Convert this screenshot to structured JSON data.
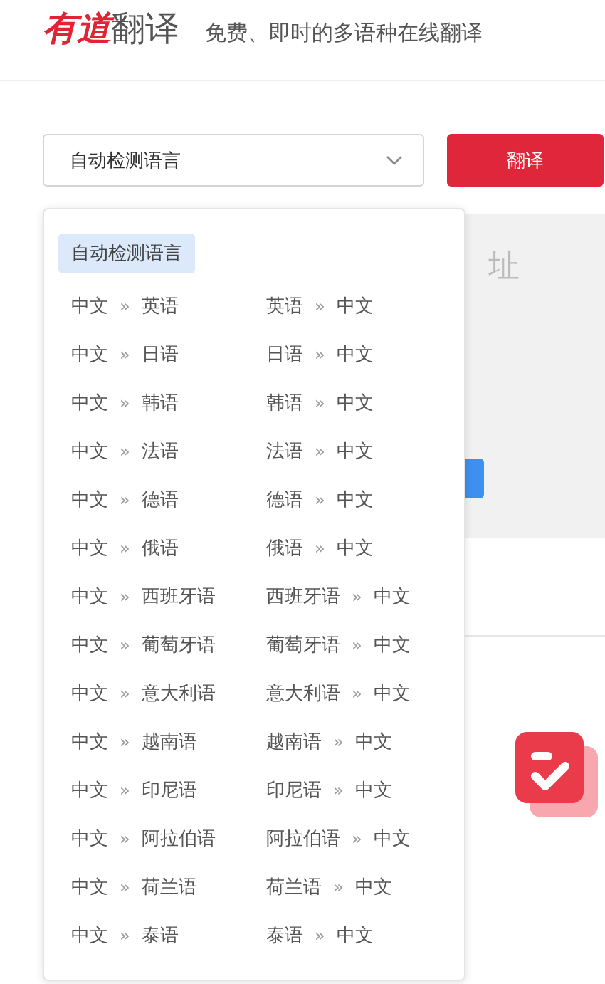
{
  "header": {
    "logo_brand": "有道",
    "logo_product": "翻译",
    "tagline": "免费、即时的多语种在线翻译"
  },
  "language_select": {
    "value": "自动检测语言",
    "expanded": true
  },
  "translate_button": "翻译",
  "input_panel": {
    "placeholder": "址"
  },
  "dropdown": {
    "auto_option": {
      "label": "自动检测语言",
      "selected": true
    },
    "pairs": [
      [
        {
          "from": "中文",
          "sep": "»",
          "to": "英语",
          "selected": false
        },
        {
          "from": "英语",
          "sep": "»",
          "to": "中文",
          "selected": false
        }
      ],
      [
        {
          "from": "中文",
          "sep": "»",
          "to": "日语",
          "selected": false
        },
        {
          "from": "日语",
          "sep": "»",
          "to": "中文",
          "selected": false
        }
      ],
      [
        {
          "from": "中文",
          "sep": "»",
          "to": "韩语",
          "selected": false
        },
        {
          "from": "韩语",
          "sep": "»",
          "to": "中文",
          "selected": false
        }
      ],
      [
        {
          "from": "中文",
          "sep": "»",
          "to": "法语",
          "selected": false
        },
        {
          "from": "法语",
          "sep": "»",
          "to": "中文",
          "selected": false
        }
      ],
      [
        {
          "from": "中文",
          "sep": "»",
          "to": "德语",
          "selected": false
        },
        {
          "from": "德语",
          "sep": "»",
          "to": "中文",
          "selected": false
        }
      ],
      [
        {
          "from": "中文",
          "sep": "»",
          "to": "俄语",
          "selected": false
        },
        {
          "from": "俄语",
          "sep": "»",
          "to": "中文",
          "selected": false
        }
      ],
      [
        {
          "from": "中文",
          "sep": "»",
          "to": "西班牙语",
          "selected": false
        },
        {
          "from": "西班牙语",
          "sep": "»",
          "to": "中文",
          "selected": false
        }
      ],
      [
        {
          "from": "中文",
          "sep": "»",
          "to": "葡萄牙语",
          "selected": false
        },
        {
          "from": "葡萄牙语",
          "sep": "»",
          "to": "中文",
          "selected": false
        }
      ],
      [
        {
          "from": "中文",
          "sep": "»",
          "to": "意大利语",
          "selected": false
        },
        {
          "from": "意大利语",
          "sep": "»",
          "to": "中文",
          "selected": false
        }
      ],
      [
        {
          "from": "中文",
          "sep": "»",
          "to": "越南语",
          "selected": false
        },
        {
          "from": "越南语",
          "sep": "»",
          "to": "中文",
          "selected": false
        }
      ],
      [
        {
          "from": "中文",
          "sep": "»",
          "to": "印尼语",
          "selected": false
        },
        {
          "from": "印尼语",
          "sep": "»",
          "to": "中文",
          "selected": false
        }
      ],
      [
        {
          "from": "中文",
          "sep": "»",
          "to": "阿拉伯语",
          "selected": false
        },
        {
          "from": "阿拉伯语",
          "sep": "»",
          "to": "中文",
          "selected": false
        }
      ],
      [
        {
          "from": "中文",
          "sep": "»",
          "to": "荷兰语",
          "selected": false
        },
        {
          "from": "荷兰语",
          "sep": "»",
          "to": "中文",
          "selected": false
        }
      ],
      [
        {
          "from": "中文",
          "sep": "»",
          "to": "泰语",
          "selected": false
        },
        {
          "from": "泰语",
          "sep": "»",
          "to": "中文",
          "selected": false
        }
      ]
    ]
  }
}
